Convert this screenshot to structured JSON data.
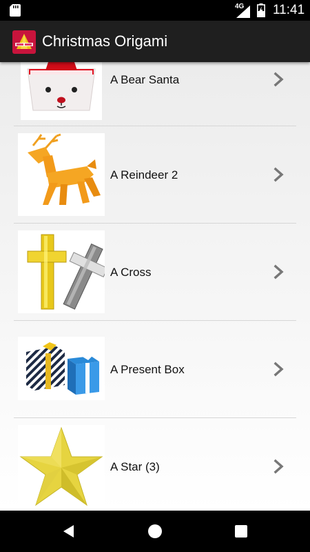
{
  "status_bar": {
    "time": "11:41",
    "network": "4G"
  },
  "app_bar": {
    "title": "Christmas Origami"
  },
  "items": [
    {
      "label": "A Bear Santa"
    },
    {
      "label": "A Reindeer 2"
    },
    {
      "label": "A Cross"
    },
    {
      "label": "A Present Box"
    },
    {
      "label": "A Star (3)"
    }
  ],
  "icons": {
    "sd": "sd-card-icon",
    "signal": "signal-icon",
    "battery": "battery-icon",
    "chevron": "chevron-right-icon",
    "back": "back-icon",
    "home": "home-icon",
    "recents": "recents-icon"
  },
  "colors": {
    "app_bar": "#1f1f1f",
    "status_bar": "#000000",
    "chevron": "#777777"
  }
}
